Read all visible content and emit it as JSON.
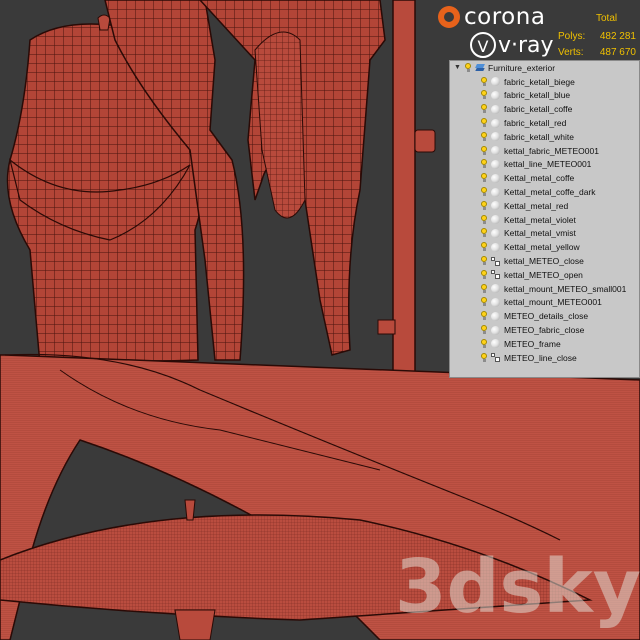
{
  "overlay": {
    "corona_label": "corona",
    "vray_label": "v·ray",
    "vray_mark": "V",
    "watermark": "3dsky"
  },
  "stats": {
    "total_label": "Total",
    "polys_label": "Polys:",
    "polys_value": "482 281",
    "verts_label": "Verts:",
    "verts_value": "487 670"
  },
  "layers": {
    "root": {
      "label": "Furniture_exterior",
      "icon": "layer-stack-icon"
    },
    "items": [
      {
        "label": "fabric_ketall_biege",
        "icon": "sphere-icon"
      },
      {
        "label": "fabric_ketall_blue",
        "icon": "sphere-icon"
      },
      {
        "label": "fabric_ketall_coffe",
        "icon": "sphere-icon"
      },
      {
        "label": "fabric_ketall_red",
        "icon": "sphere-icon"
      },
      {
        "label": "fabric_ketall_white",
        "icon": "sphere-icon"
      },
      {
        "label": "kettal_fabric_METEO001",
        "icon": "sphere-icon"
      },
      {
        "label": "kettal_line_METEO001",
        "icon": "sphere-icon"
      },
      {
        "label": "Kettal_metal_coffe",
        "icon": "sphere-icon"
      },
      {
        "label": "Kettal_metal_coffe_dark",
        "icon": "sphere-icon"
      },
      {
        "label": "Kettal_metal_red",
        "icon": "sphere-icon"
      },
      {
        "label": "Kettal_metal_violet",
        "icon": "sphere-icon"
      },
      {
        "label": "Kettal_metal_vmist",
        "icon": "sphere-icon"
      },
      {
        "label": "Kettal_metal_yellow",
        "icon": "sphere-icon"
      },
      {
        "label": "kettal_METEO_close",
        "icon": "group-icon"
      },
      {
        "label": "kettal_METEO_open",
        "icon": "group-icon"
      },
      {
        "label": "kettal_mount_METEO_small001",
        "icon": "sphere-icon"
      },
      {
        "label": "kettal_mount_METEO001",
        "icon": "sphere-icon"
      },
      {
        "label": "METEO_details_close",
        "icon": "sphere-icon"
      },
      {
        "label": "METEO_fabric_close",
        "icon": "sphere-icon"
      },
      {
        "label": "METEO_frame",
        "icon": "sphere-icon"
      },
      {
        "label": "METEO_line_close",
        "icon": "group-icon"
      }
    ]
  },
  "colors": {
    "background": "#3a3a3a",
    "mesh_fill": "#b84a3c",
    "mesh_wire": "#5a1a12",
    "stats_text": "#f0c000",
    "corona_orange": "#e7621b",
    "panel_bg": "#c8c8c8"
  }
}
